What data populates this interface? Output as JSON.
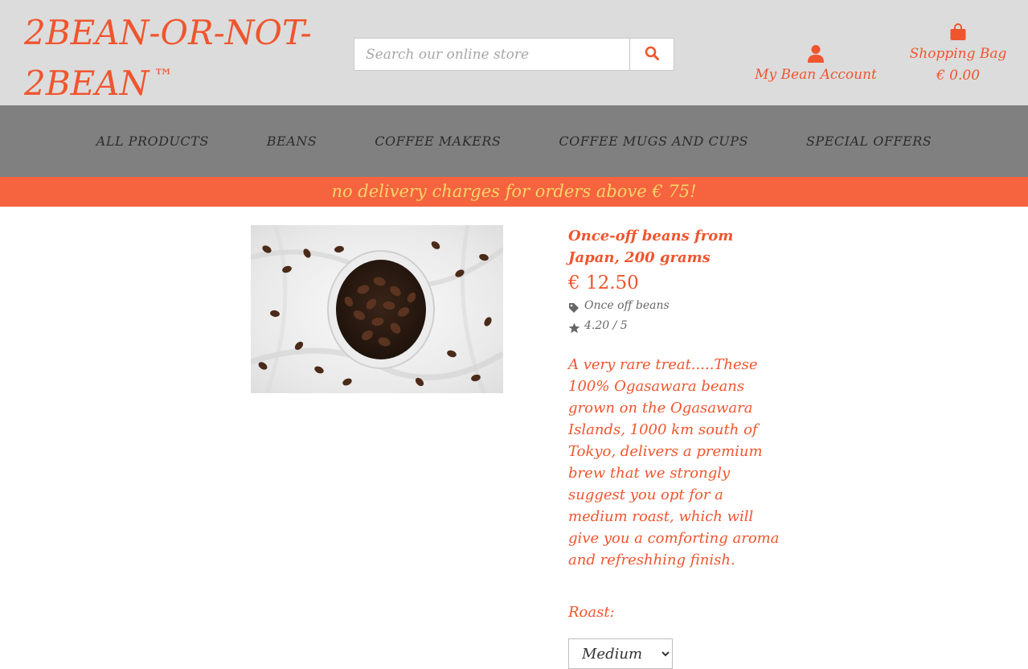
{
  "header": {
    "logo": "2BEAN-OR-NOT-2BEAN",
    "logo_tm": "™",
    "search_placeholder": "Search our online store",
    "account_label": "My Bean Account",
    "bag_label": "Shopping Bag",
    "bag_total": "€ 0.00",
    "icons": {
      "search": "search-icon",
      "account": "user-icon",
      "bag": "shopping-bag-icon"
    }
  },
  "nav": {
    "items": [
      "ALL PRODUCTS",
      "BEANS",
      "COFFEE MAKERS",
      "COFFEE MUGS AND CUPS",
      "SPECIAL OFFERS"
    ]
  },
  "promo": "no delivery charges for orders above € 75!",
  "product": {
    "title": "Once-off beans from Japan, 200 grams",
    "price": "€ 12.50",
    "category": "Once off beans",
    "rating": "4.20 / 5",
    "description": "A very rare treat.....These 100% Ogasawara beans grown on the Ogasawara Islands, 1000 km south of Tokyo, delivers a premium brew that we strongly suggest you opt for a medium roast, which will give you a comforting aroma and refreshhing finish.",
    "roast_label": "Roast:",
    "roast_selected": "Medium",
    "image_alt": "coffee beans in white cup"
  },
  "colors": {
    "accent": "#f0552e",
    "header_bg": "#dcdcdc",
    "nav_bg": "#808080",
    "promo_bg": "#f5633f",
    "promo_text": "#f7d56a"
  }
}
